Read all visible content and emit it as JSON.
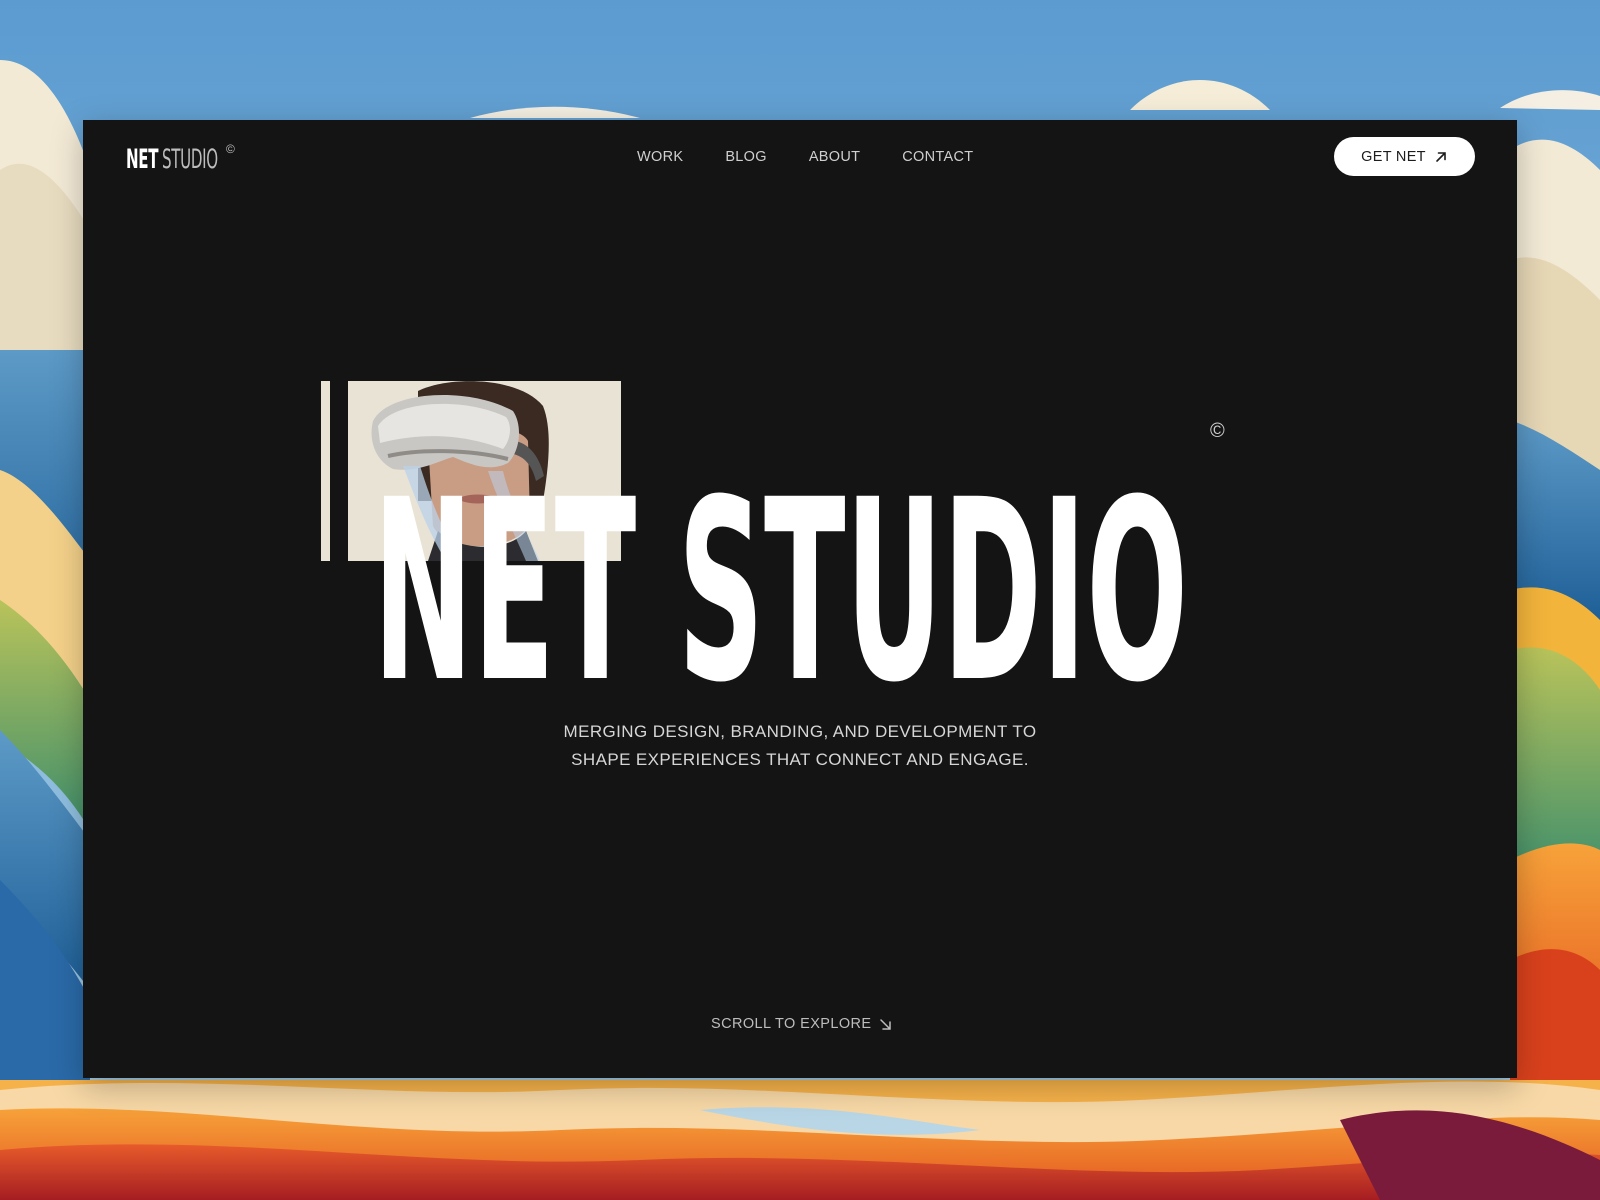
{
  "header": {
    "logo_primary": "NET",
    "logo_secondary": "STUDIO",
    "logo_mark": "©",
    "nav": [
      "WORK",
      "BLOG",
      "ABOUT",
      "CONTACT"
    ],
    "cta_label": "GET NET",
    "cta_icon": "arrow-up-right-icon"
  },
  "hero": {
    "title": "NET STUDIO",
    "title_mark": "©",
    "tagline_line1": "MERGING DESIGN, BRANDING, AND DEVELOPMENT TO",
    "tagline_line2": "SHAPE EXPERIENCES THAT CONNECT AND ENGAGE.",
    "image": "person-wearing-vr-headset"
  },
  "footer": {
    "scroll_label": "SCROLL TO EXPLORE",
    "scroll_icon": "arrow-down-right-icon"
  },
  "colors": {
    "page_bg": "#141414",
    "text_primary": "#ffffff",
    "text_muted": "#cfcfcf",
    "button_bg": "#ffffff",
    "button_text": "#1c1c1c"
  }
}
